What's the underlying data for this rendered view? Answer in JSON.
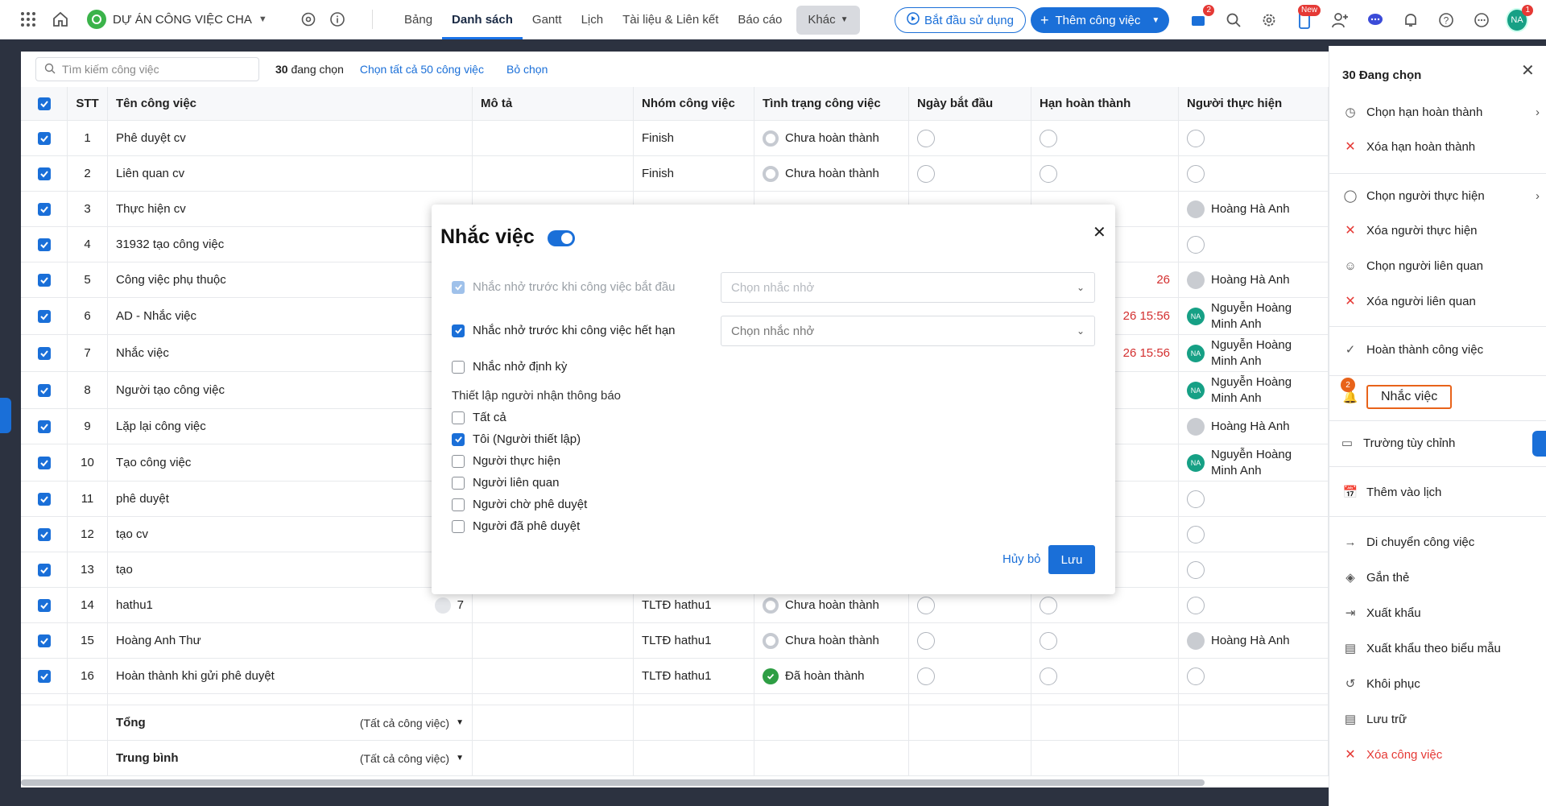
{
  "topbar": {
    "project_name": "DỰ ÁN CÔNG VIỆC CHA",
    "tabs": [
      "Bảng",
      "Danh sách",
      "Gantt",
      "Lịch",
      "Tài liệu & Liên kết",
      "Báo cáo"
    ],
    "more_label": "Khác",
    "start_label": "Bắt đầu sử dụng",
    "add_label": "Thêm công việc",
    "cart_badge": "2",
    "new_badge": "New",
    "avatar_initials": "NA",
    "avatar_badge": "1"
  },
  "toolbar": {
    "search_placeholder": "Tìm kiếm công việc",
    "selected_count": "30",
    "selected_text": "đang chọn",
    "select_all": "Chọn tất cả 50 công việc",
    "deselect": "Bỏ chọn"
  },
  "table": {
    "headers": [
      "STT",
      "Tên công việc",
      "Mô tả",
      "Nhóm công việc",
      "Tình trạng công việc",
      "Ngày bắt đầu",
      "Hạn hoàn thành",
      "Người thực hiện"
    ],
    "rows": [
      {
        "stt": "1",
        "name": "Phê duyệt cv",
        "group": "Finish",
        "status": "Chưa hoàn thành",
        "user": ""
      },
      {
        "stt": "2",
        "name": "Liên quan cv",
        "group": "Finish",
        "status": "Chưa hoàn thành",
        "user": ""
      },
      {
        "stt": "3",
        "name": "Thực hiện cv",
        "group": "",
        "status": "",
        "user": "Hoàng Hà Anh"
      },
      {
        "stt": "4",
        "name": "31932 tạo công việc",
        "group": "",
        "status": "",
        "user": ""
      },
      {
        "stt": "5",
        "name": "Công việc phụ thuộc",
        "group": "",
        "status": "",
        "due": "26",
        "user": "Hoàng Hà Anh"
      },
      {
        "stt": "6",
        "name": "AD - Nhắc việc",
        "group": "",
        "status": "",
        "due": "26 15:56",
        "user": "Nguyễn Hoàng Minh Anh"
      },
      {
        "stt": "7",
        "name": "Nhắc việc",
        "group": "",
        "status": "",
        "due": "26 15:56",
        "user": "Nguyễn Hoàng Minh Anh"
      },
      {
        "stt": "8",
        "name": "Người tạo công việc",
        "group": "",
        "status": "",
        "user": "Nguyễn Hoàng Minh Anh"
      },
      {
        "stt": "9",
        "name": "Lặp lại công việc",
        "group": "",
        "status": "",
        "user": "Hoàng Hà Anh"
      },
      {
        "stt": "10",
        "name": "Tạo công việc",
        "group": "",
        "status": "",
        "user": "Nguyễn Hoàng Minh Anh"
      },
      {
        "stt": "11",
        "name": "phê duyệt",
        "group": "",
        "status": "",
        "user": ""
      },
      {
        "stt": "12",
        "name": "tạo cv",
        "group": "",
        "status": "",
        "user": ""
      },
      {
        "stt": "13",
        "name": "tạo",
        "group": "",
        "status": "",
        "user": ""
      },
      {
        "stt": "14",
        "name": "hathu1",
        "attach": "7",
        "group": "TLTĐ hathu1",
        "status": "Chưa hoàn thành",
        "user": ""
      },
      {
        "stt": "15",
        "name": "Hoàng Anh Thư",
        "group": "TLTĐ hathu1",
        "status": "Chưa hoàn thành",
        "user": "Hoàng Hà Anh"
      },
      {
        "stt": "16",
        "name": "Hoàn thành khi gửi phê duyệt",
        "group": "TLTĐ hathu1",
        "status": "Đã hoàn thành",
        "user": ""
      }
    ],
    "footer": [
      {
        "label": "Tổng",
        "sub": "(Tất cả công việc)"
      },
      {
        "label": "Trung bình",
        "sub": "(Tất cả công việc)"
      }
    ]
  },
  "sidepanel": {
    "title": "30 Đang chọn",
    "items": {
      "chon_han": "Chọn hạn hoàn thành",
      "xoa_han": "Xóa hạn hoàn thành",
      "chon_nth": "Chọn người thực hiện",
      "xoa_nth": "Xóa người thực hiện",
      "chon_nlq": "Chọn người liên quan",
      "xoa_nlq": "Xóa người liên quan",
      "hoan_thanh": "Hoàn thành công việc",
      "nhac_viec": "Nhắc việc",
      "nhac_badge": "2",
      "truong": "Trường tùy chỉnh",
      "them_lich": "Thêm vào lịch",
      "di_chuyen": "Di chuyển công việc",
      "gan_the": "Gắn thẻ",
      "xuat_khau": "Xuất khẩu",
      "xuat_bm": "Xuất khẩu theo biểu mẫu",
      "khoi_phuc": "Khôi phục",
      "luu_tru": "Lưu trữ",
      "xoa_cv": "Xóa công việc"
    }
  },
  "modal": {
    "title": "Nhắc việc",
    "opt_start": "Nhắc nhở trước khi công việc bắt đầu",
    "opt_due": "Nhắc nhở trước khi công việc hết hạn",
    "opt_periodic": "Nhắc nhở định kỳ",
    "dd_placeholder_1": "Chọn nhắc nhở",
    "dd_placeholder_2": "Chọn nhắc nhở",
    "recipients_title": "Thiết lập người nhận thông báo",
    "recipients": [
      "Tất cả",
      "Tôi (Người thiết lập)",
      "Người thực hiện",
      "Người liên quan",
      "Người chờ phê duyệt",
      "Người đã phê duyệt"
    ],
    "cancel": "Hủy bỏ",
    "save": "Lưu"
  },
  "colors": {
    "accent": "#1a6fd8",
    "danger": "#e53935",
    "highlight": "#e8631a"
  }
}
